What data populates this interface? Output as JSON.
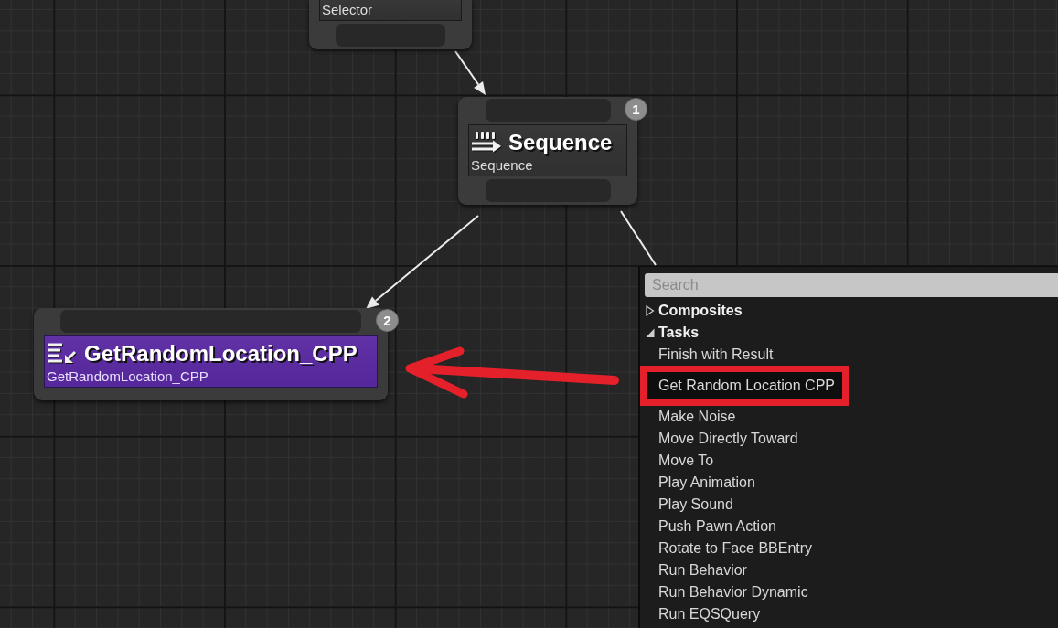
{
  "graph": {
    "nodes": [
      {
        "kind": "composite",
        "subtitle": "Selector"
      },
      {
        "kind": "composite",
        "title": "Sequence",
        "subtitle": "Sequence",
        "order": "1"
      },
      {
        "kind": "task",
        "title": "GetRandomLocation_CPP",
        "subtitle": "GetRandomLocation_CPP",
        "order": "2"
      }
    ]
  },
  "annotations": [
    {
      "kind": "arrow"
    }
  ],
  "menu": {
    "search": {
      "placeholder": "Search"
    },
    "categories": [
      {
        "label": "Composites",
        "expanded": false
      },
      {
        "label": "Tasks",
        "expanded": true,
        "children": [
          {
            "label": "Finish with Result",
            "selected": false,
            "outlined": false
          },
          {
            "label": "Get Random Location CPP",
            "selected": true,
            "outlined": true
          },
          {
            "label": "Make Noise",
            "selected": false,
            "outlined": false
          },
          {
            "label": "Move Directly Toward",
            "selected": false,
            "outlined": false
          },
          {
            "label": "Move To",
            "selected": false,
            "outlined": false
          },
          {
            "label": "Play Animation",
            "selected": false,
            "outlined": false
          },
          {
            "label": "Play Sound",
            "selected": false,
            "outlined": false
          },
          {
            "label": "Push Pawn Action",
            "selected": false,
            "outlined": false
          },
          {
            "label": "Rotate to Face BBEntry",
            "selected": false,
            "outlined": false
          },
          {
            "label": "Run Behavior",
            "selected": false,
            "outlined": false
          },
          {
            "label": "Run Behavior Dynamic",
            "selected": false,
            "outlined": false
          },
          {
            "label": "Run EQSQuery",
            "selected": false,
            "outlined": false
          }
        ]
      }
    ]
  }
}
